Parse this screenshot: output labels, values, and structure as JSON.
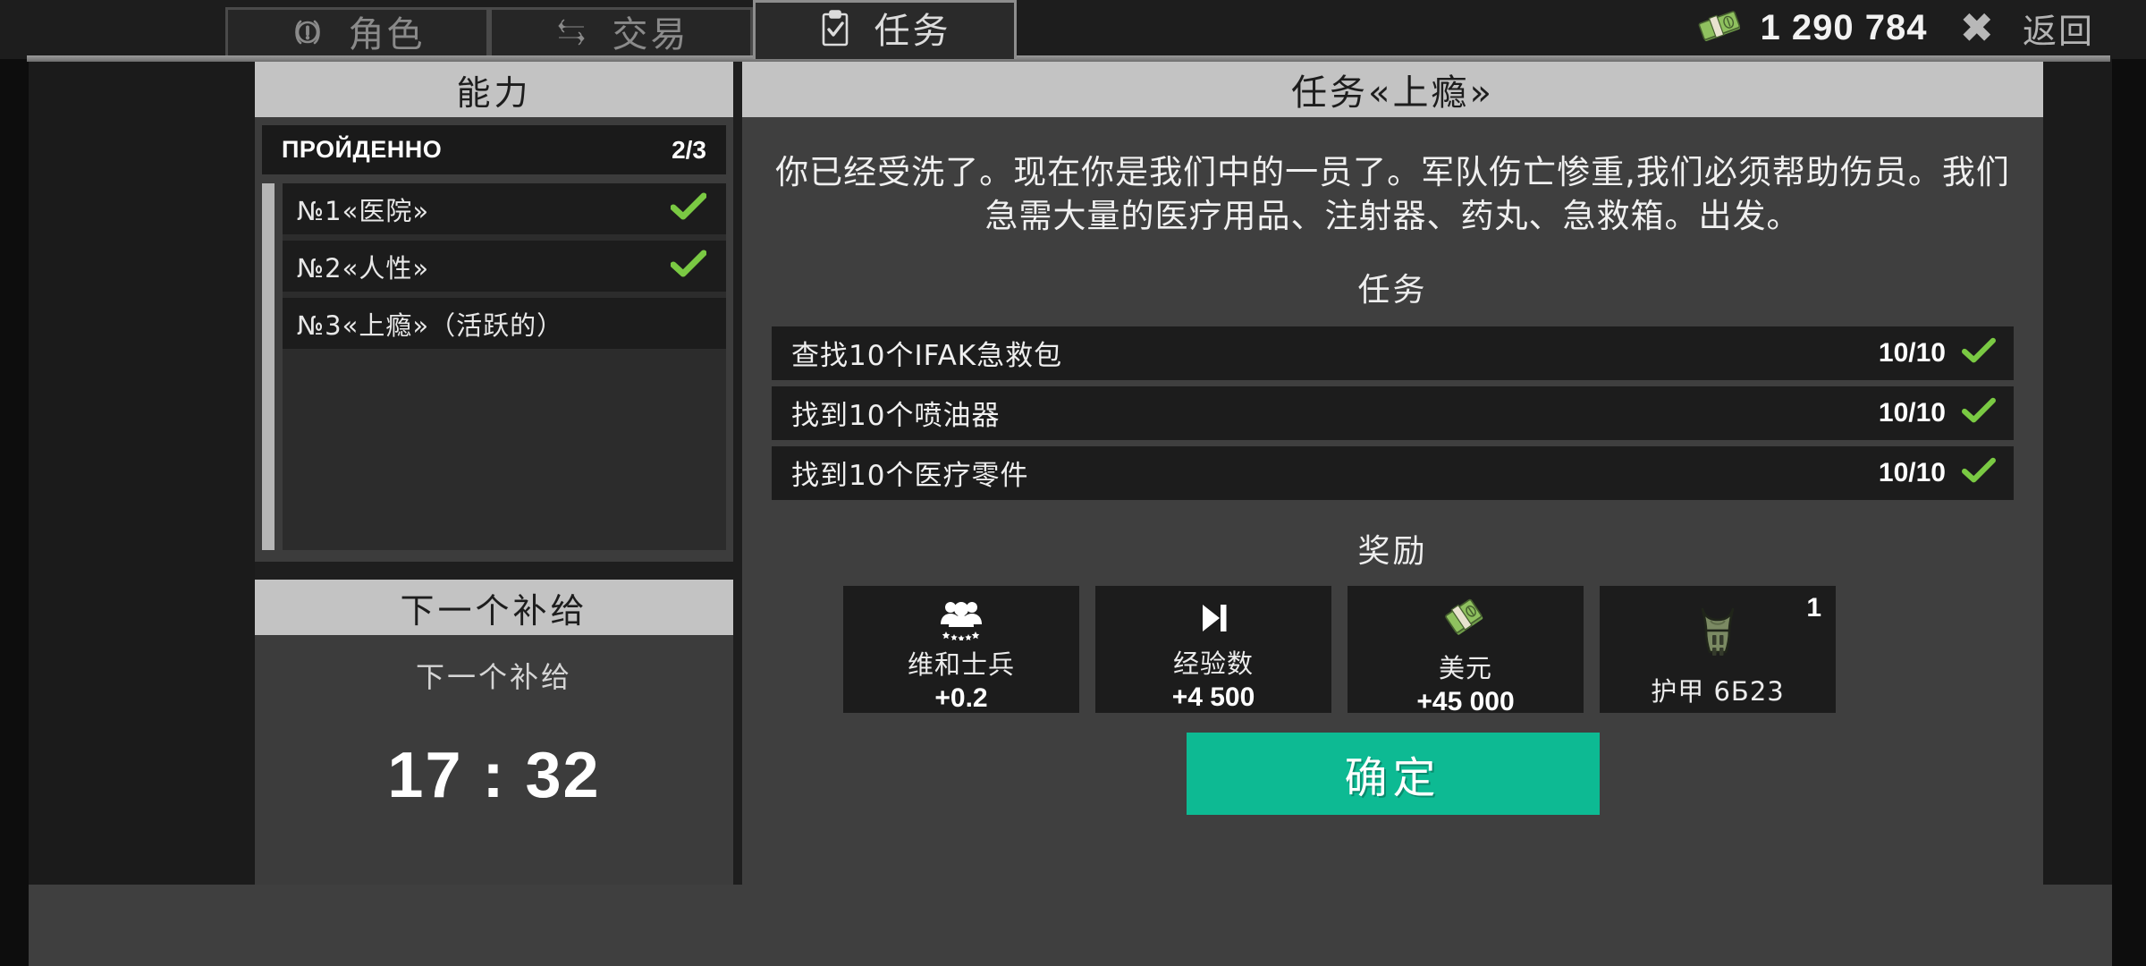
{
  "topbar": {
    "tabs": [
      {
        "id": "character",
        "label": "角色",
        "icon": "alert-exclamation-icon",
        "active": false
      },
      {
        "id": "trade",
        "label": "交易",
        "icon": "exchange-arrows-icon",
        "active": false
      },
      {
        "id": "tasks",
        "label": "任务",
        "icon": "clipboard-check-icon",
        "active": true
      }
    ],
    "money": {
      "icon": "cash-stack-icon",
      "amount": "1 290 784"
    },
    "close": {
      "icon": "close-x-icon",
      "label": "返回"
    }
  },
  "sidebar": {
    "header": "能力",
    "progress": {
      "label": "ПРОЙДЕННО",
      "count": "2/3"
    },
    "quests": [
      {
        "name": "№1«医院»",
        "completed": true,
        "active": false
      },
      {
        "name": "№2«人性»",
        "completed": true,
        "active": false
      },
      {
        "name": "№3«上瘾»（活跃的）",
        "completed": false,
        "active": true
      }
    ],
    "supply": {
      "header": "下一个补给",
      "subtitle": "下一个补给",
      "timer": "17 : 32"
    }
  },
  "main": {
    "title": "任务«上瘾»",
    "description": "你已经受洗了。现在你是我们中的一员了。军队伤亡惨重,我们必须帮助伤员。我们急需大量的医疗用品、注射器、药丸、急救箱。出发。",
    "objectives_title": "任务",
    "objectives": [
      {
        "text_prefix": "查找",
        "amount": "10",
        "text_suffix": "个IFAK急救包",
        "text": "查找10个IFAK急救包",
        "count": "10/10",
        "completed": true
      },
      {
        "text_prefix": "找到",
        "amount": "10",
        "text_suffix": "个喷油器",
        "text": "找到10个喷油器",
        "count": "10/10",
        "completed": true
      },
      {
        "text_prefix": "找到",
        "amount": "10",
        "text_suffix": "个医疗零件",
        "text": "找到10个医疗零件",
        "count": "10/10",
        "completed": true
      }
    ],
    "rewards_title": "奖励",
    "rewards": [
      {
        "icon": "people-group-stars-icon",
        "name": "维和士兵",
        "value": "+0.2",
        "qty": ""
      },
      {
        "icon": "skip-forward-icon",
        "name": "经验数",
        "value": "+4 500",
        "qty": ""
      },
      {
        "icon": "cash-stack-icon",
        "name": "美元",
        "value": "+45 000",
        "qty": ""
      },
      {
        "icon": "body-armor-icon",
        "name": "护甲 6Б23",
        "value": "",
        "qty": "1"
      }
    ],
    "confirm_label": "确定"
  },
  "colors": {
    "accent_confirm": "#0dba93",
    "check_green": "#7ac943",
    "panel_header": "#c3c3c3",
    "panel_body": "#3f3f3f",
    "row_dark": "#1c1c1c",
    "background": "#1b1b1b"
  }
}
